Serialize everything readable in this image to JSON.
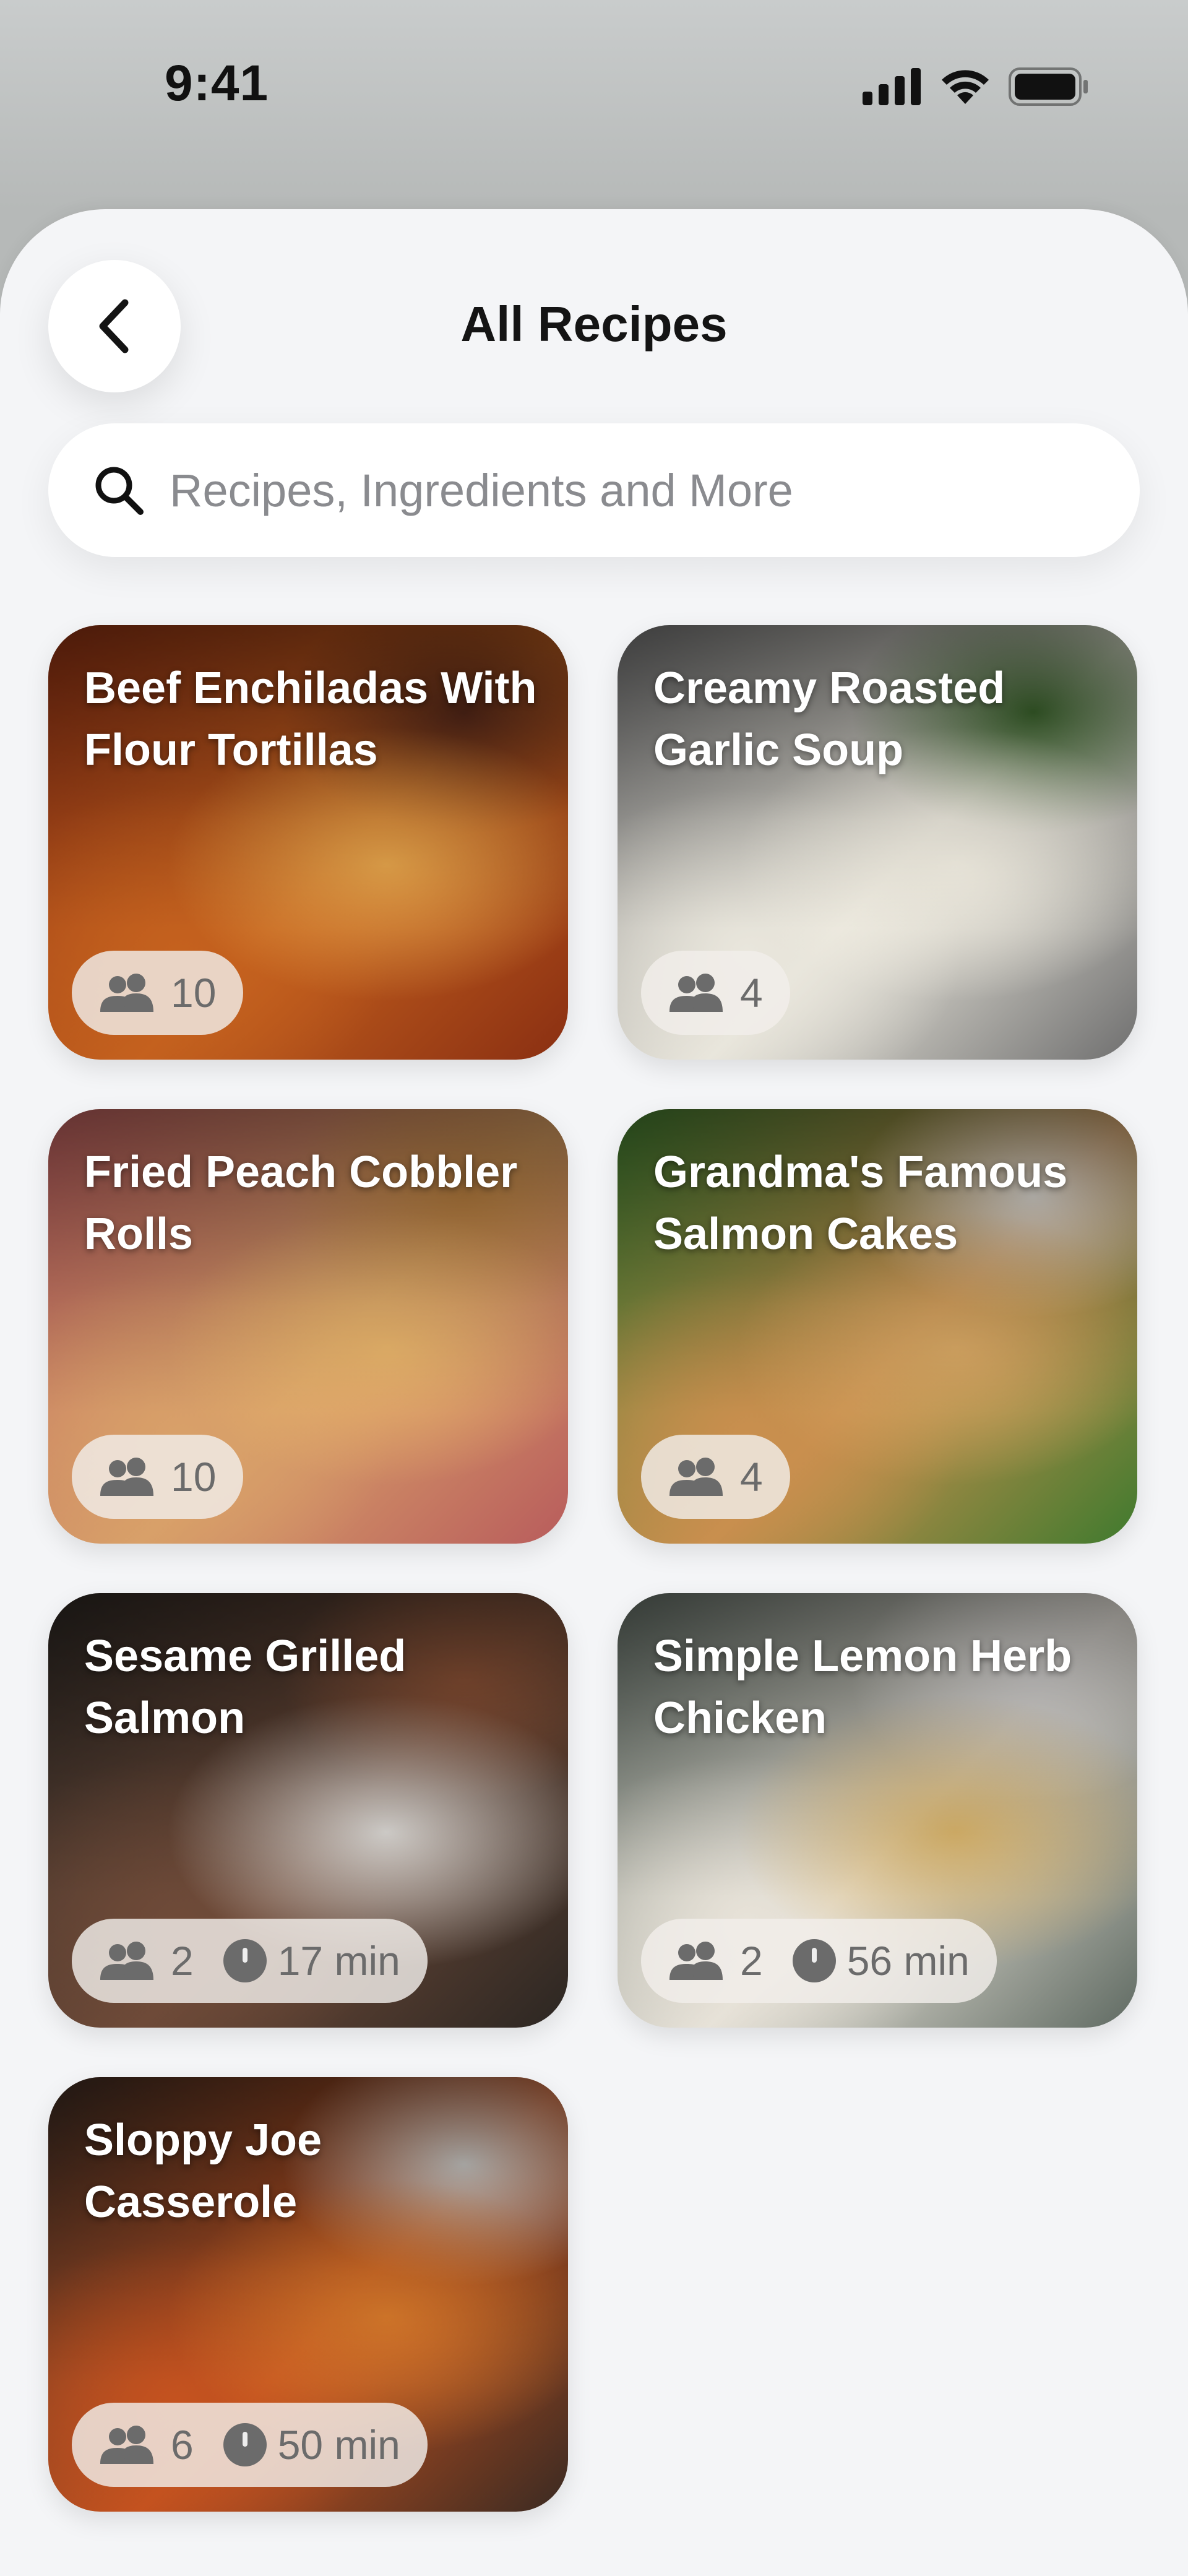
{
  "status_bar": {
    "time": "9:41"
  },
  "header": {
    "title": "All Recipes"
  },
  "search": {
    "placeholder": "Recipes, Ingredients and More"
  },
  "recipes": [
    {
      "title": "Beef Enchiladas With Flour Tortillas",
      "servings": "10",
      "time": null,
      "palette": [
        "#8a2f12",
        "#c4611e",
        "#e3a24a",
        "#5a2a1a"
      ]
    },
    {
      "title": "Creamy Roasted Garlic Soup",
      "servings": "4",
      "time": null,
      "palette": [
        "#6f6f6f",
        "#e9e6dc",
        "#f3efe3",
        "#3f6b2f"
      ]
    },
    {
      "title": "Fried Peach Cobbler Rolls",
      "servings": "10",
      "time": null,
      "palette": [
        "#b85c5c",
        "#d8a069",
        "#e7b36a",
        "#c98a45"
      ]
    },
    {
      "title": "Grandma's Famous Salmon Cakes",
      "servings": "4",
      "time": null,
      "palette": [
        "#3f7a2e",
        "#c98f4e",
        "#d6a663",
        "#f0ece4"
      ]
    },
    {
      "title": "Sesame Grilled Salmon",
      "servings": "2",
      "time": "17 min",
      "palette": [
        "#2b2622",
        "#6e4a38",
        "#d9d6d2",
        "#9a5a3b"
      ]
    },
    {
      "title": "Simple Lemon Herb Chicken",
      "servings": "2",
      "time": "56 min",
      "palette": [
        "#5f6a62",
        "#e7e2d8",
        "#d8b36a",
        "#f2f0ee"
      ]
    },
    {
      "title": "Sloppy Joe Casserole",
      "servings": "6",
      "time": "50 min",
      "palette": [
        "#3a2a22",
        "#c4521f",
        "#d97a2b",
        "#e9e7e3"
      ]
    }
  ],
  "colors": {
    "sheet_bg": "#f4f5f7",
    "pill_text": "#6b6b6b",
    "title_text": "#141414"
  }
}
